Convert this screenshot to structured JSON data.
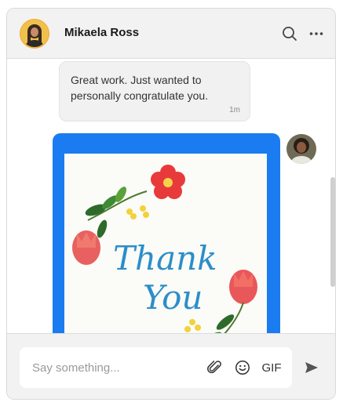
{
  "header": {
    "contact_name": "Mikaela Ross",
    "icons": [
      "avatar",
      "search-icon",
      "more-icon"
    ]
  },
  "messages": [
    {
      "type": "text",
      "text": "Great work. Just wanted to personally congratulate you.",
      "time": "1m"
    },
    {
      "type": "image",
      "image_text_line1": "Thank",
      "image_text_line2": "You"
    }
  ],
  "composer": {
    "placeholder": "Say something...",
    "gif_label": "GIF",
    "icons": [
      "paperclip-icon",
      "emoji-icon",
      "send-icon"
    ]
  },
  "colors": {
    "accent": "#1a7cf0",
    "header_bg": "#f2f2f2",
    "bubble_bg": "#f1f1f1",
    "avatar_ring": "#f4b13e"
  }
}
